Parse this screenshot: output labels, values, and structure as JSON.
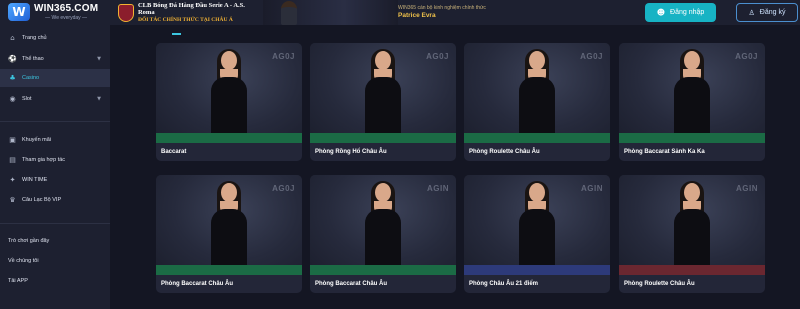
{
  "header": {
    "logo_mark": "W",
    "logo_name": "WIN365.COM",
    "logo_tag": "— We everyday —",
    "roma_title": "CLB Bóng Đá Hàng Đầu Serie A - A.S. Roma",
    "roma_sub": "ĐỐI TÁC CHÍNH THỨC TẠI CHÂU Á",
    "ambassador_sub": "WIN365 cán bộ kinh nghiệm chính thức",
    "ambassador_name": "Patrice Evra",
    "login_label": "Đăng nhập",
    "register_label": "Đăng ký"
  },
  "sidebar": {
    "items": [
      {
        "label": "Trang chủ",
        "icon": "home-icon"
      },
      {
        "label": "Thể thao",
        "icon": "sports-icon"
      },
      {
        "label": "Casino",
        "icon": "casino-icon"
      },
      {
        "label": "Slot",
        "icon": "slot-icon"
      }
    ],
    "extras": [
      {
        "label": "Khuyến mãi",
        "icon": "gift-icon"
      },
      {
        "label": "Tham gia hợp tác",
        "icon": "partner-icon"
      },
      {
        "label": "WIN TIME",
        "icon": "clock-icon"
      },
      {
        "label": "Câu Lạc Bộ VIP",
        "icon": "crown-icon"
      }
    ],
    "links": [
      "Trò chơi gần đây",
      "Về chúng tôi",
      "Tải APP"
    ]
  },
  "games": [
    {
      "title": "Baccarat",
      "brand": "AG0J",
      "table": "green"
    },
    {
      "title": "Phòng Rồng Hổ Châu Âu",
      "brand": "AG0J",
      "table": "green"
    },
    {
      "title": "Phòng Roulette Châu Âu",
      "brand": "AG0J",
      "table": "green"
    },
    {
      "title": "Phòng Baccarat Sảnh Ka Ka",
      "brand": "AG0J",
      "table": "green"
    },
    {
      "title": "Phòng Baccarat Châu Âu",
      "brand": "AG0J",
      "table": "green"
    },
    {
      "title": "Phòng Baccarat Châu Âu",
      "brand": "AGIN",
      "table": "green"
    },
    {
      "title": "Phòng Châu Âu 21 điểm",
      "brand": "AGIN",
      "table": "blue"
    },
    {
      "title": "Phòng Roulette Châu Âu",
      "brand": "AGIN",
      "table": "red"
    }
  ],
  "colors": {
    "accent": "#3cc6e0",
    "login_bg": "#17b3c4",
    "background": "#141623",
    "sidebar": "#1d2030"
  }
}
